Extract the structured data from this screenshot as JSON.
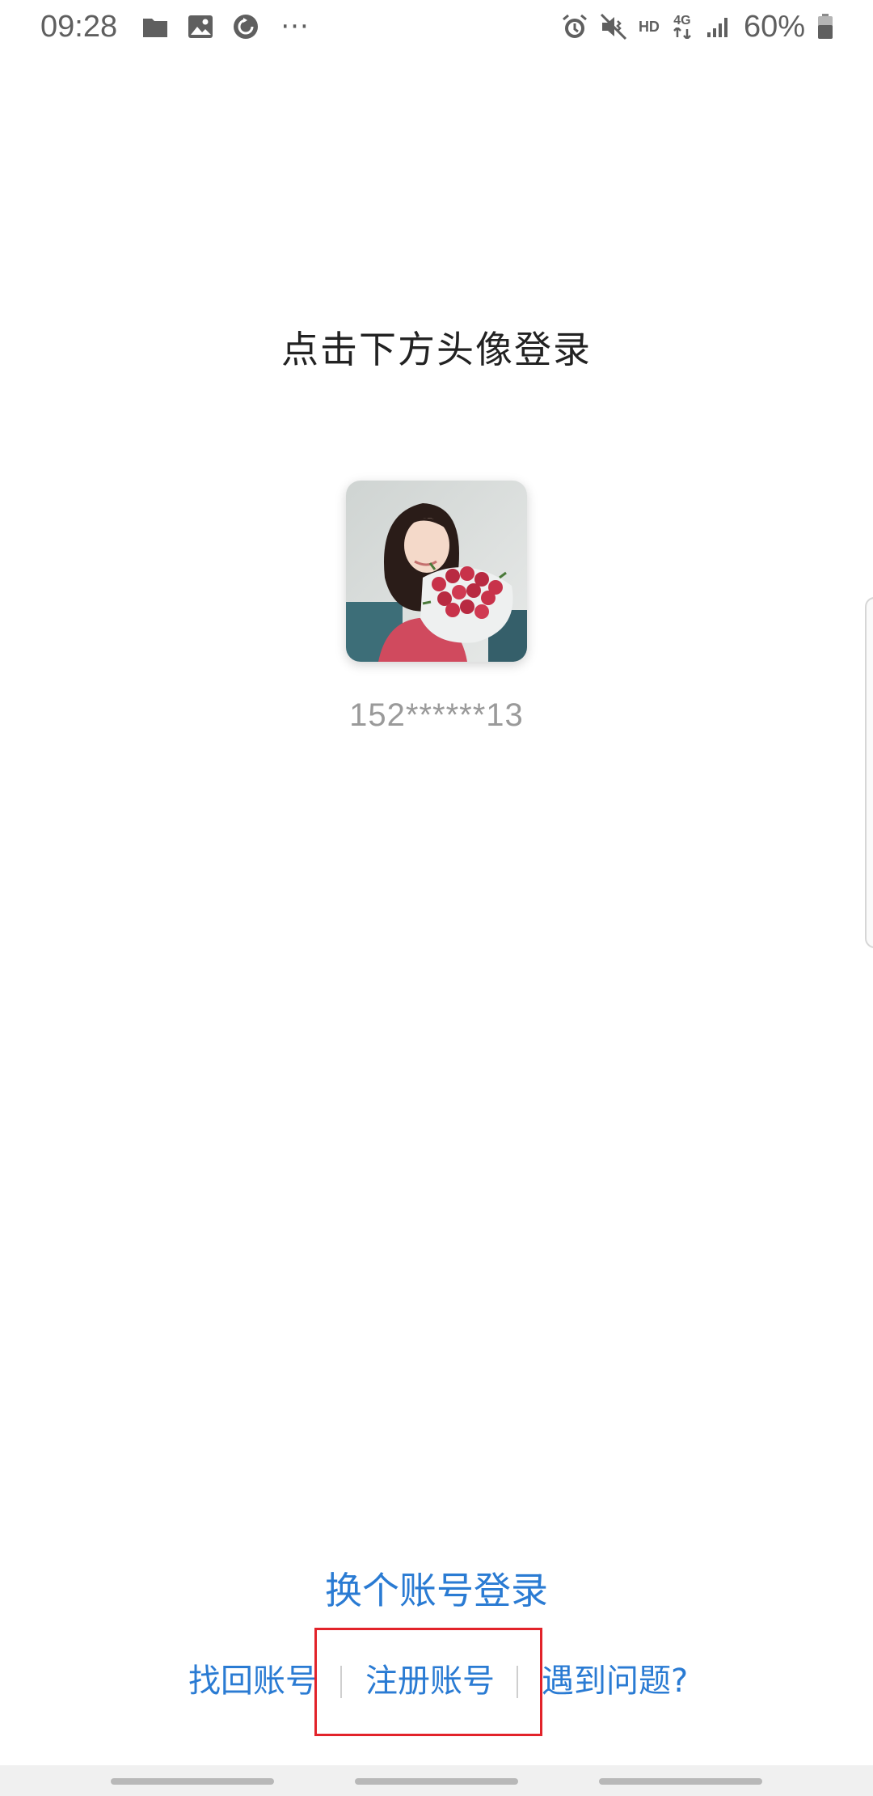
{
  "status_bar": {
    "time": "09:28",
    "left_icons": [
      "folder-icon",
      "image-icon",
      "sync-icon",
      "more-dots-icon"
    ],
    "more_dots": "···",
    "right_icons": [
      "alarm-icon",
      "mute-vibrate-icon",
      "hd-icon",
      "4g-icon",
      "signal-icon",
      "battery-icon"
    ],
    "hd_label": "HD",
    "network_label": "4G",
    "battery_percent": "60%"
  },
  "login": {
    "title": "点击下方头像登录",
    "avatar_alt": "user-avatar",
    "masked_phone": "152******13"
  },
  "actions": {
    "switch_account": "换个账号登录",
    "recover_account": "找回账号",
    "register_account": "注册账号",
    "having_problems": "遇到问题?"
  },
  "colors": {
    "link": "#2a7bd3",
    "highlight": "#e2232a",
    "title": "#222222",
    "muted": "#9a9a9a"
  }
}
